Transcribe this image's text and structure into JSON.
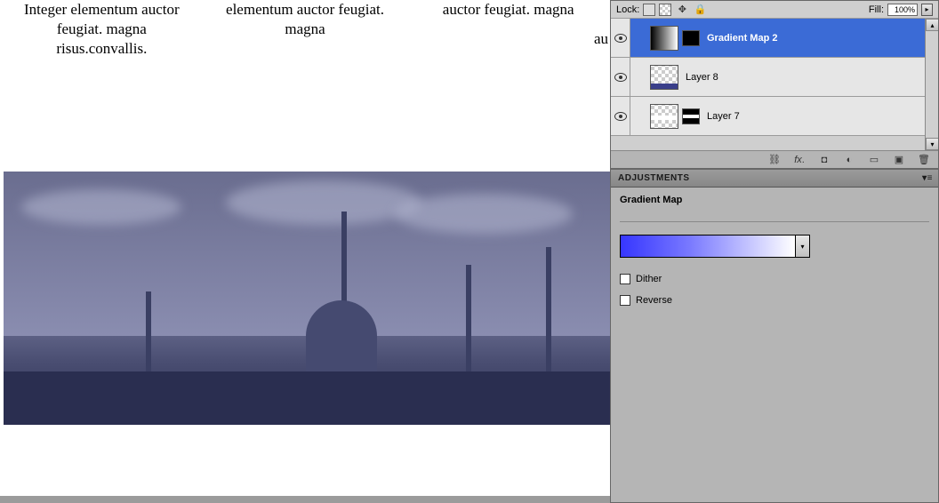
{
  "canvas": {
    "col1": "Integer elementum auctor feugiat. magna risus.convallis.",
    "col2": "elementum auctor feugiat. magna",
    "col3": "auctor feugiat. magna",
    "partial": "au"
  },
  "layers_panel": {
    "lock_label": "Lock:",
    "fill_label": "Fill:",
    "fill_value": "100%",
    "layers": [
      {
        "name": "Gradient Map 2",
        "selected": true,
        "has_mask": true
      },
      {
        "name": "Layer 8",
        "selected": false,
        "has_mask": false
      },
      {
        "name": "Layer 7",
        "selected": false,
        "has_mask": true
      }
    ]
  },
  "adjustments_panel": {
    "tab": "ADJUSTMENTS",
    "title": "Gradient Map",
    "dither_label": "Dither",
    "reverse_label": "Reverse"
  }
}
